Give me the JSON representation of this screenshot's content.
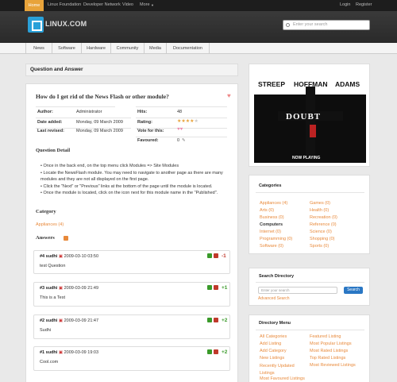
{
  "topnav": {
    "home": "Home",
    "items": [
      "Linux Foundation",
      "Developer Network",
      "Video",
      "More"
    ],
    "login": "Login",
    "register": "Register"
  },
  "logo": {
    "text": "LINUX.COM"
  },
  "search": {
    "placeholder": "Enter your search"
  },
  "mainnav": [
    "News",
    "Software",
    "Hardware",
    "Community",
    "Media",
    "Documentation"
  ],
  "panel_title": "Question and Answer",
  "question": {
    "title": "How do I get rid of the News Flash or other module?",
    "author_label": "Author:",
    "author": "Administrator",
    "added_label": "Date added:",
    "added": "Monday, 09 March 2009",
    "revised_label": "Last revised:",
    "revised": "Monday, 09 March 2009",
    "hits_label": "Hits:",
    "hits": "48",
    "rating_label": "Rating:",
    "rating_value": 4,
    "vote_label": "Vote for this:",
    "fav_label": "Favoured:",
    "fav": "0"
  },
  "detail": {
    "heading": "Question Detail",
    "items": [
      "Once in the back end, on the top menu click Modules => Site Modules",
      "Locate the NewsFlash module. You may need to navigate to another page as there are many modules and they are not all displayed on the first page.",
      "Click the \"Next\" or \"Previous\" links at the bottom of the page until the module is located.",
      "Once the module is located, click on the icon next for this module name in the \"Published\"."
    ]
  },
  "category": {
    "heading": "Category",
    "value": "Appliances (4)"
  },
  "answers": {
    "heading": "Answers",
    "list": [
      {
        "num": "#4",
        "user": "sudhi",
        "date": "2009-03-10 03:50",
        "text": "test Question",
        "score": "-1"
      },
      {
        "num": "#3",
        "user": "sudhi",
        "date": "2009-03-09 21:49",
        "text": "This is a Test",
        "score": "+1"
      },
      {
        "num": "#2",
        "user": "sudhi",
        "date": "2009-03-09 21:47",
        "text": "Sudhi",
        "score": "+2"
      },
      {
        "num": "#1",
        "user": "sudhi",
        "date": "2009-03-09 19:03",
        "text": "Cool.com",
        "score": "+2"
      }
    ]
  },
  "ad": {
    "actors": [
      "STREEP",
      "HOFFMAN",
      "ADAMS"
    ],
    "title": "DOUBT",
    "sub": "NOW PLAYING"
  },
  "categories": {
    "title": "Categories",
    "left": [
      "Appliances (4)",
      "Arts (0)",
      "Business (0)",
      "Computers",
      "Internet (0)",
      "Programming (0)",
      "Software (0)"
    ],
    "right": [
      "Games (0)",
      "Health (0)",
      "Recreation (0)",
      "Reference (0)",
      "Science (0)",
      "Shopping (0)",
      "Sports (0)"
    ]
  },
  "searchdir": {
    "title": "Search Directory",
    "placeholder": "Enter your search",
    "button": "Search",
    "advanced": "Advanced Search"
  },
  "dirmenu": {
    "title": "Directory Menu",
    "left": [
      "All Categories",
      "Add Listing",
      "Add Category",
      "New Listings",
      "Recently Updated Listings",
      "Most Favoured Listings"
    ],
    "right": [
      "Featured Listing",
      "Most Popular Listings",
      "Most Rated Listings",
      "Top Rated Listings",
      "Most Reviewed Listings"
    ]
  },
  "colors": {
    "accent": "#e8893a",
    "green": "#3a9a2a",
    "red": "#c0392b"
  }
}
